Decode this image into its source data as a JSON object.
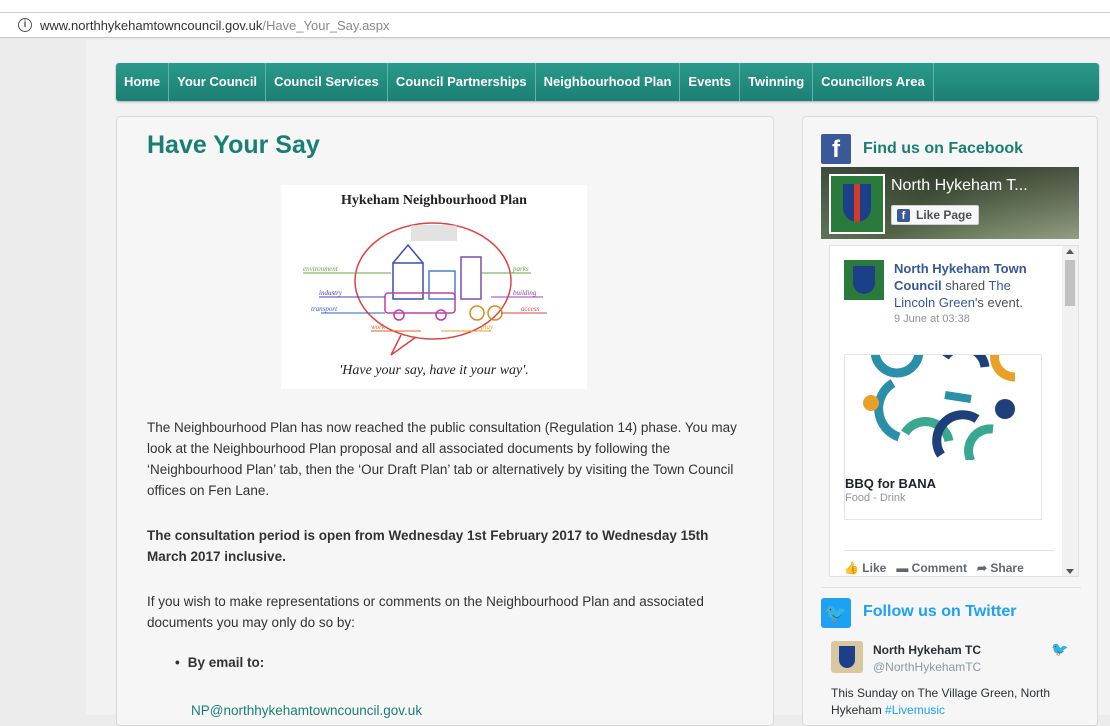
{
  "browser": {
    "url_domain": "www.northhykehamtowncouncil.gov.uk",
    "url_path": "/Have_Your_Say.aspx"
  },
  "nav": {
    "items": [
      "Home",
      "Your Council",
      "Council Services",
      "Council Partnerships",
      "Neighbourhood Plan",
      "Events",
      "Twinning",
      "Councillors Area"
    ]
  },
  "main": {
    "title": "Have Your Say",
    "logo_title": "Hykeham Neighbourhood Plan",
    "logo_slogan": "'Have your say, have it your way'.",
    "logo_words": [
      "environment",
      "parks",
      "industry",
      "building",
      "transport",
      "access",
      "work",
      "play"
    ],
    "paragraph1": "The Neighbourhood Plan has now reached the public consultation (Regulation 14) phase. You may look at the Neighbourhood Plan proposal and all associated documents by following the ‘Neighbourhood Plan’ tab, then the ‘Our Draft Plan’ tab or alternatively by visiting the Town Council offices on Fen Lane.",
    "paragraph2": "The consultation period is open from Wednesday 1st February 2017 to Wednesday 15th March 2017 inclusive.",
    "paragraph3": "If you wish to make representations or comments on the Neighbourhood Plan and associated documents you may only do so by:",
    "bullet1": "By email to:",
    "email": "NP@northhykehamtowncouncil.gov.uk"
  },
  "sidebar": {
    "facebook": {
      "heading": "Find us on Facebook",
      "page_name": "North Hykeham T...",
      "like_label": "Like Page",
      "post_author": "North Hykeham Town Council",
      "post_action": "shared",
      "post_link": "The Lincoln Green",
      "post_suffix": "'s event.",
      "post_time": "9 June at 03:38",
      "event_title": "BBQ for BANA",
      "event_category": "Food - Drink",
      "actions": [
        "Like",
        "Comment",
        "Share"
      ]
    },
    "twitter": {
      "heading": "Follow us on Twitter",
      "name": "North Hykeham TC",
      "handle": "@NorthHykehamTC",
      "tweet": "This Sunday on The Village Green, North Hykeham ",
      "hashtag": "#Livemusic"
    }
  },
  "colors": {
    "nav_bg": "#1f8a7d",
    "title": "#1a7f73",
    "facebook": "#3b5998",
    "twitter": "#1da1f2"
  }
}
